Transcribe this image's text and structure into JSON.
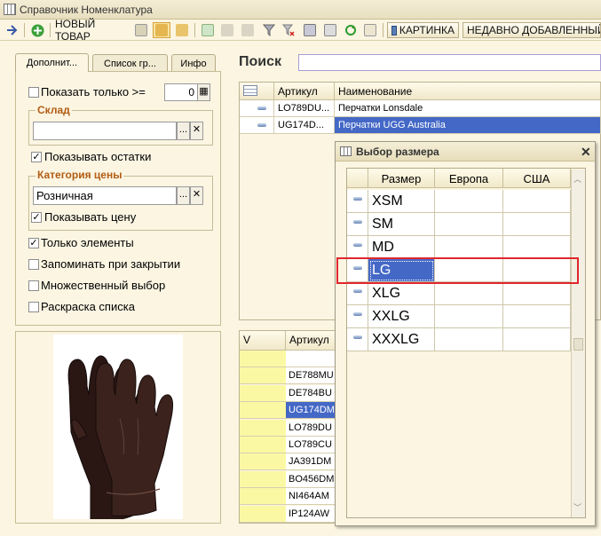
{
  "window": {
    "title": "Справочник Номенклатура"
  },
  "toolbar": {
    "new_item": "НОВЫЙ ТОВАР",
    "picture": "КАРТИНКА",
    "recent": "НЕДАВНО ДОБАВЛЕННЫЙ Т"
  },
  "tabs": [
    {
      "label": "Дополнит..."
    },
    {
      "label": "Список гр..."
    },
    {
      "label": "Инфо"
    }
  ],
  "filters": {
    "show_only_label": "Показать только >=",
    "show_only_value": "0",
    "warehouse_label": "Склад",
    "warehouse_value": "",
    "show_stock_label": "Показывать остатки",
    "price_category_label": "Категория цены",
    "price_category_value": "Розничная",
    "show_price_label": "Показывать цену",
    "only_elements_label": "Только элементы",
    "remember_label": "Запоминать при закрытии",
    "multi_select_label": "Множественный выбор",
    "coloring_label": "Раскраска списка",
    "ellipsis": "...",
    "clear": "✕"
  },
  "search": {
    "label": "Поиск",
    "value": ""
  },
  "top_grid": {
    "headers": {
      "article": "Артикул",
      "name": "Наименование"
    },
    "rows": [
      {
        "article": "LO789DU...",
        "name": "Перчатки Lonsdale"
      },
      {
        "article": "UG174D...",
        "name": "Перчатки UGG Australia"
      }
    ]
  },
  "bottom_grid": {
    "headers": {
      "v": "V",
      "article": "Артикул"
    },
    "rows": [
      "",
      "DE788MU",
      "DE784BU",
      "UG174DM",
      "LO789DU",
      "LO789CU",
      "JA391DM",
      "BO456DM",
      "NI464AM",
      "IP124AW"
    ]
  },
  "size_dialog": {
    "title": "Выбор размера",
    "close": "✕",
    "headers": {
      "size": "Размер",
      "europe": "Европа",
      "usa": "США"
    },
    "rows": [
      "XSM",
      "SM",
      "MD",
      "LG",
      "XLG",
      "XXLG",
      "XXXLG"
    ],
    "selected": "LG"
  },
  "colors": {
    "selection": "#4468c6",
    "highlight_frame": "#e0262d",
    "yellow_cell": "#fbf8a4",
    "group_label": "#b25c13"
  }
}
